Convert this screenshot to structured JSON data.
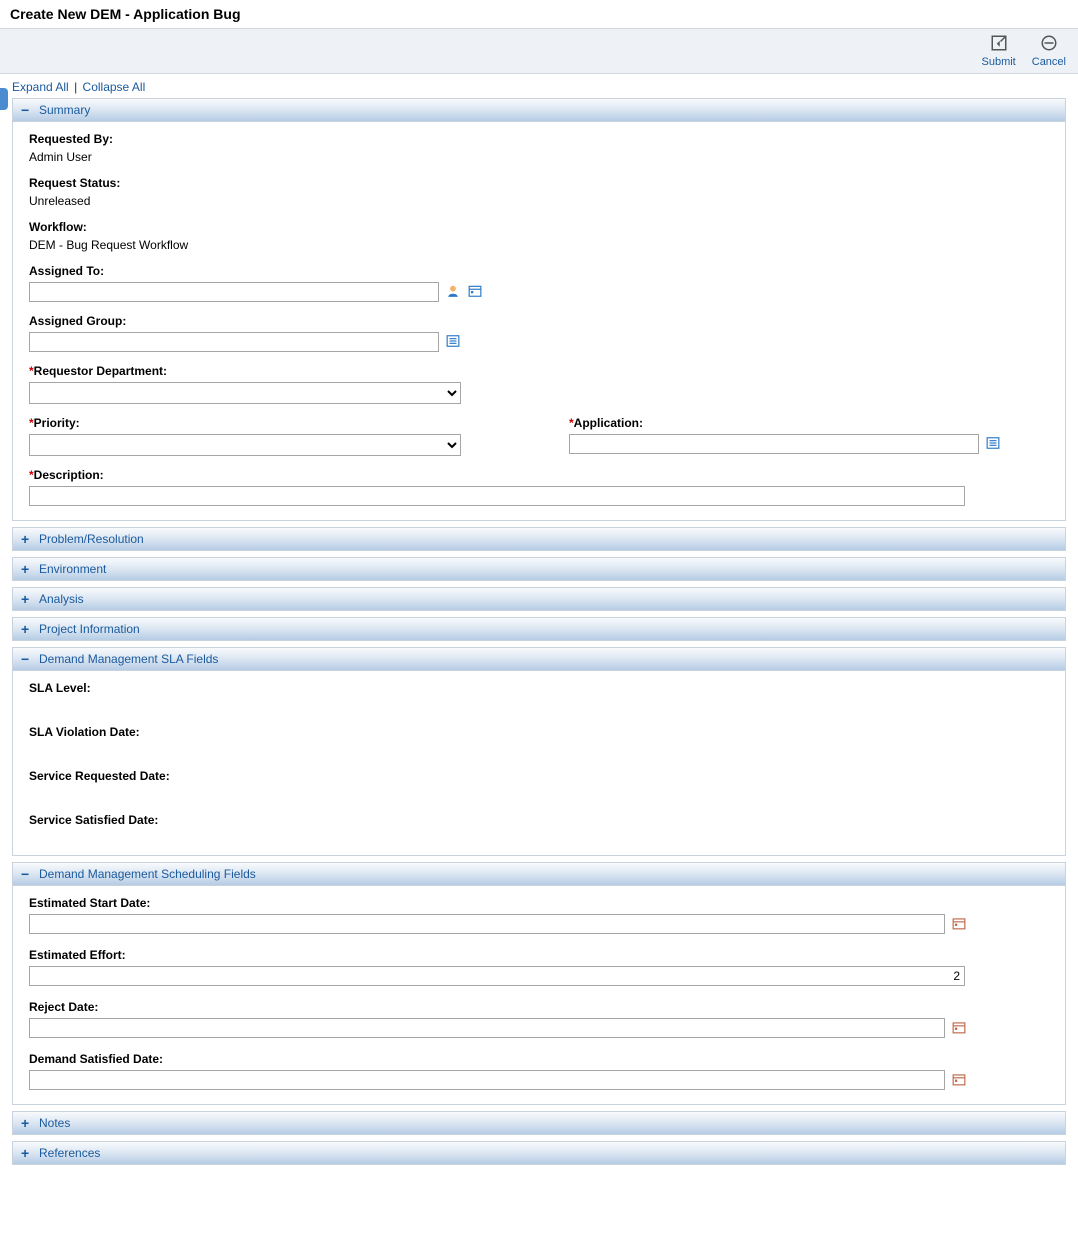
{
  "page_title": "Create New DEM - Application Bug",
  "toolbar": {
    "submit": "Submit",
    "cancel": "Cancel"
  },
  "links": {
    "expand_all": "Expand All",
    "collapse_all": "Collapse All"
  },
  "sections": {
    "summary": {
      "title": "Summary",
      "requested_by_label": "Requested By:",
      "requested_by_value": "Admin User",
      "request_status_label": "Request Status:",
      "request_status_value": "Unreleased",
      "workflow_label": "Workflow:",
      "workflow_value": "DEM - Bug Request Workflow",
      "assigned_to_label": "Assigned To:",
      "assigned_to_value": "",
      "assigned_group_label": "Assigned Group:",
      "assigned_group_value": "",
      "requestor_dept_label": "Requestor Department:",
      "priority_label": "Priority:",
      "application_label": "Application:",
      "application_value": "",
      "description_label": "Description:",
      "description_value": ""
    },
    "problem_resolution": {
      "title": "Problem/Resolution"
    },
    "environment": {
      "title": "Environment"
    },
    "analysis": {
      "title": "Analysis"
    },
    "project_information": {
      "title": "Project Information"
    },
    "sla": {
      "title": "Demand Management SLA Fields",
      "sla_level_label": "SLA Level:",
      "sla_violation_date_label": "SLA Violation Date:",
      "service_requested_date_label": "Service Requested Date:",
      "service_satisfied_date_label": "Service Satisfied Date:"
    },
    "scheduling": {
      "title": "Demand Management Scheduling Fields",
      "est_start_date_label": "Estimated Start Date:",
      "est_start_date_value": "",
      "est_effort_label": "Estimated Effort:",
      "est_effort_value": "2",
      "reject_date_label": "Reject Date:",
      "reject_date_value": "",
      "demand_satisfied_date_label": "Demand Satisfied Date:",
      "demand_satisfied_date_value": ""
    },
    "notes": {
      "title": "Notes"
    },
    "references": {
      "title": "References"
    }
  }
}
